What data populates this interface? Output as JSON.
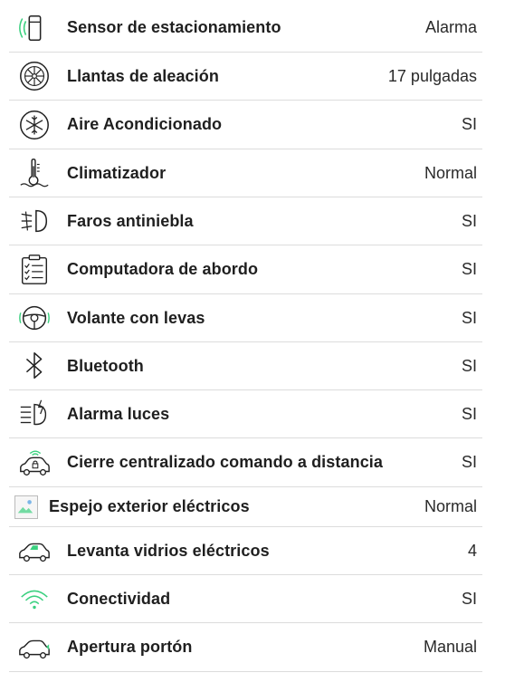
{
  "colors": {
    "accent": "#3ad07f",
    "text": "#1f1f1f",
    "divider": "#dcdcdc"
  },
  "features": [
    {
      "icon": "parking-sensor-icon",
      "label": "Sensor de estacionamiento",
      "value": "Alarma"
    },
    {
      "icon": "alloy-wheel-icon",
      "label": "Llantas de aleación",
      "value": "17 pulgadas"
    },
    {
      "icon": "snowflake-icon",
      "label": "Aire Acondicionado",
      "value": "SI"
    },
    {
      "icon": "thermometer-icon",
      "label": "Climatizador",
      "value": "Normal"
    },
    {
      "icon": "fog-light-icon",
      "label": "Faros antiniebla",
      "value": "SI"
    },
    {
      "icon": "clipboard-checklist-icon",
      "label": "Computadora de abordo",
      "value": "SI"
    },
    {
      "icon": "steering-wheel-icon",
      "label": "Volante con levas",
      "value": "SI"
    },
    {
      "icon": "bluetooth-icon",
      "label": "Bluetooth",
      "value": "SI"
    },
    {
      "icon": "headlight-alarm-icon",
      "label": "Alarma luces",
      "value": "SI"
    },
    {
      "icon": "car-remote-lock-icon",
      "label": "Cierre centralizado comando a distancia",
      "value": "SI"
    },
    {
      "icon": "broken-image-icon",
      "label": "Espejo exterior eléctricos",
      "value": "Normal"
    },
    {
      "icon": "car-window-icon",
      "label": "Levanta vidrios eléctricos",
      "value": "4"
    },
    {
      "icon": "wifi-signal-icon",
      "label": "Conectividad",
      "value": "SI"
    },
    {
      "icon": "car-trunk-icon",
      "label": "Apertura portón",
      "value": "Manual"
    }
  ]
}
